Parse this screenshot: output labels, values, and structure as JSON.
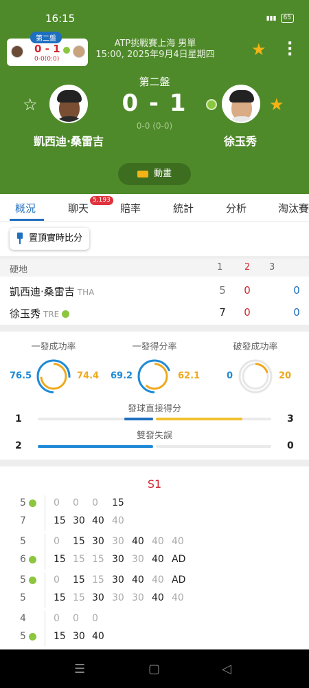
{
  "status": {
    "time": "16:15",
    "battery": "65"
  },
  "match": {
    "mini_tag": "第二盤",
    "mini_score": "0 - 1",
    "mini_sub": "0-0(0:0)",
    "tournament": "ATP挑戰賽上海 男單",
    "datetime": "15:00, 2025年9月4日星期四",
    "set_label": "第二盤",
    "score": "0 - 1",
    "game_score": "0-0 (0-0)",
    "player1": "凱西迪·桑雷吉",
    "player2": "徐玉秀",
    "animation_label": "動畫"
  },
  "tabs": [
    {
      "label": "概況"
    },
    {
      "label": "聊天"
    },
    {
      "label": "賠率"
    },
    {
      "label": "統計"
    },
    {
      "label": "分析"
    },
    {
      "label": "淘汰賽"
    }
  ],
  "chat_badge": "5,193",
  "pin_button": "置頂實時比分",
  "scoreboard": {
    "surface": "硬地",
    "set_headers": [
      "1",
      "2",
      "3"
    ],
    "rows": [
      {
        "name": "凱西迪·桑雷吉",
        "country": "THA",
        "sets": [
          "5",
          "0",
          "0"
        ]
      },
      {
        "name": "徐玉秀",
        "country": "TRE",
        "sets": [
          "7",
          "0",
          "0"
        ]
      }
    ]
  },
  "stats": {
    "rings": [
      {
        "title": "一發成功率",
        "left": "76.5",
        "right": "74.4"
      },
      {
        "title": "一發得分率",
        "left": "69.2",
        "right": "62.1"
      },
      {
        "title": "破發成功率",
        "left": "0",
        "right": "20"
      }
    ],
    "bars": [
      {
        "title": "發球直接得分",
        "left": "1",
        "right": "3"
      },
      {
        "title": "雙發失誤",
        "left": "2",
        "right": "0"
      }
    ]
  },
  "pbp": {
    "set_label": "S1",
    "games": [
      {
        "top_score": "5",
        "bottom_score": "7",
        "top_check": true,
        "bottom_check": false,
        "top": [
          "0",
          "0",
          "0",
          "15"
        ],
        "bottom": [
          "15",
          "30",
          "40",
          "40"
        ]
      },
      {
        "top_score": "5",
        "bottom_score": "6",
        "top_check": false,
        "bottom_check": true,
        "top": [
          "0",
          "15",
          "30",
          "30",
          "40",
          "40",
          "40"
        ],
        "bottom": [
          "15",
          "15",
          "15",
          "30",
          "30",
          "40",
          "AD"
        ]
      },
      {
        "top_score": "5",
        "bottom_score": "5",
        "top_check": true,
        "bottom_check": false,
        "top": [
          "0",
          "15",
          "15",
          "30",
          "40",
          "40",
          "AD"
        ],
        "bottom": [
          "15",
          "15",
          "30",
          "30",
          "30",
          "40",
          "40"
        ]
      },
      {
        "top_score": "4",
        "bottom_score": "5",
        "top_check": false,
        "bottom_check": true,
        "top": [
          "0",
          "0",
          "0"
        ],
        "bottom": [
          "15",
          "30",
          "40"
        ]
      }
    ]
  }
}
